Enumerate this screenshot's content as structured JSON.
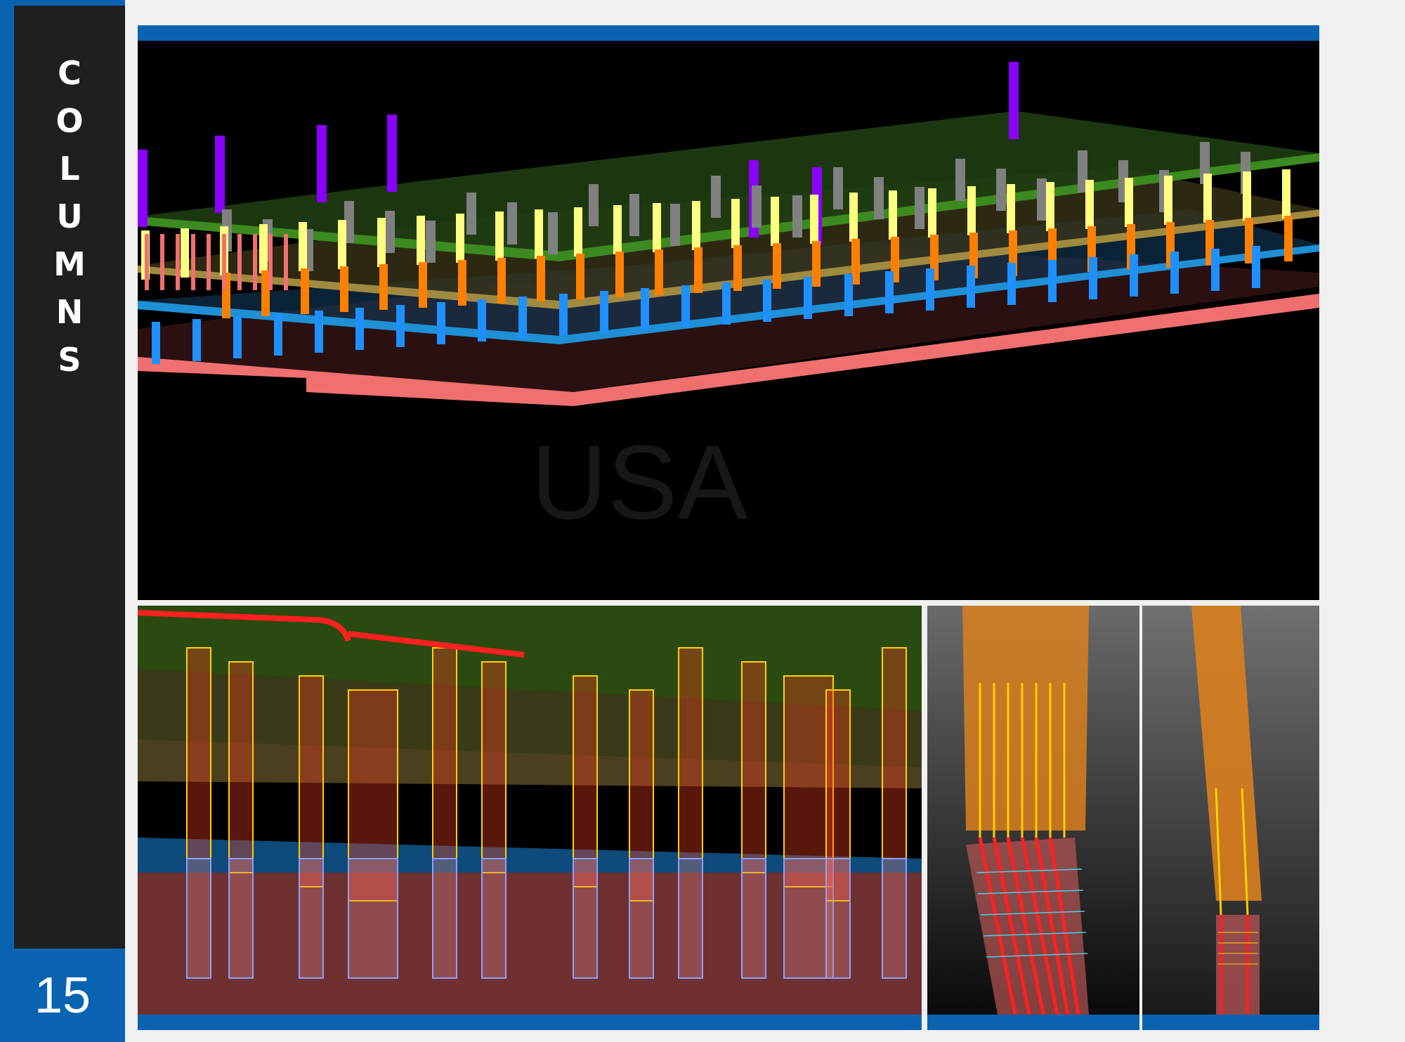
{
  "sidebar": {
    "title_letters": [
      "C",
      "O",
      "L",
      "U",
      "M",
      "N",
      "S"
    ],
    "page_number": "15"
  },
  "colors": {
    "accent_blue": "#0a63b1",
    "rail_dark": "#1f1f1f",
    "level_1": "#f07070",
    "level_2": "#1e90ff",
    "level_3": "#ff8000",
    "level_4": "#ffff80",
    "level_5": "#808080",
    "level_6": "#8a00ff"
  },
  "images": {
    "top": "3d-structural-model-columns-overview",
    "bottom_left": "3d-rebar-detail-columns",
    "bottom_middle": "inclined-column-rebar-splice-detail",
    "bottom_right": "column-transition-rebar-detail"
  }
}
